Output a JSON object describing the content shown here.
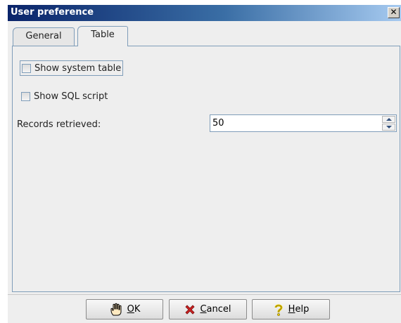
{
  "window": {
    "title": "User preference",
    "close_label": "✕"
  },
  "tabs": [
    {
      "label": "General",
      "selected": false
    },
    {
      "label": "Table",
      "selected": true
    }
  ],
  "options": {
    "show_system_table": {
      "label": "Show system table",
      "checked": false
    },
    "show_sql_script": {
      "label": "Show SQL script",
      "checked": false
    }
  },
  "records": {
    "label": "Records retrieved:",
    "value": "50"
  },
  "buttons": {
    "ok": {
      "mnemonic": "O",
      "rest": "K",
      "icon": "hand-icon"
    },
    "cancel": {
      "mnemonic": "C",
      "rest": "ancel",
      "icon": "red-x-icon"
    },
    "help": {
      "mnemonic": "H",
      "rest": "elp",
      "icon": "question-icon"
    }
  },
  "colors": {
    "titlebar_start": "#0a246a",
    "titlebar_end": "#a6caf0",
    "cancel_icon": "#cc2222",
    "help_icon": "#e8c800"
  }
}
